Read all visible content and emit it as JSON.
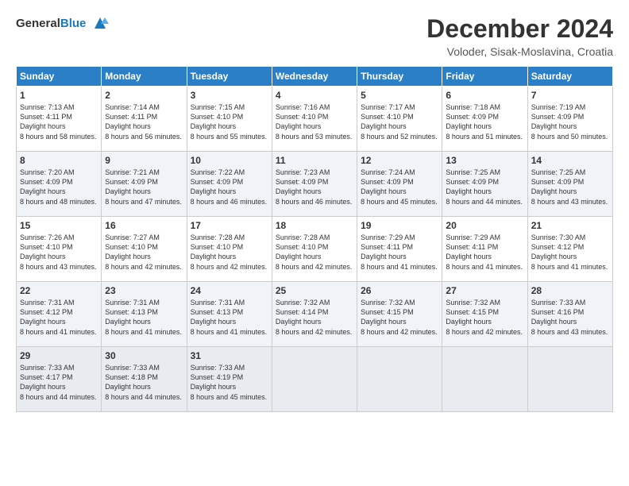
{
  "logo": {
    "line1": "General",
    "line2": "Blue"
  },
  "title": "December 2024",
  "location": "Voloder, Sisak-Moslavina, Croatia",
  "days_of_week": [
    "Sunday",
    "Monday",
    "Tuesday",
    "Wednesday",
    "Thursday",
    "Friday",
    "Saturday"
  ],
  "weeks": [
    [
      {
        "day": "1",
        "sunrise": "7:13 AM",
        "sunset": "4:11 PM",
        "daylight": "8 hours and 58 minutes."
      },
      {
        "day": "2",
        "sunrise": "7:14 AM",
        "sunset": "4:11 PM",
        "daylight": "8 hours and 56 minutes."
      },
      {
        "day": "3",
        "sunrise": "7:15 AM",
        "sunset": "4:10 PM",
        "daylight": "8 hours and 55 minutes."
      },
      {
        "day": "4",
        "sunrise": "7:16 AM",
        "sunset": "4:10 PM",
        "daylight": "8 hours and 53 minutes."
      },
      {
        "day": "5",
        "sunrise": "7:17 AM",
        "sunset": "4:10 PM",
        "daylight": "8 hours and 52 minutes."
      },
      {
        "day": "6",
        "sunrise": "7:18 AM",
        "sunset": "4:09 PM",
        "daylight": "8 hours and 51 minutes."
      },
      {
        "day": "7",
        "sunrise": "7:19 AM",
        "sunset": "4:09 PM",
        "daylight": "8 hours and 50 minutes."
      }
    ],
    [
      {
        "day": "8",
        "sunrise": "7:20 AM",
        "sunset": "4:09 PM",
        "daylight": "8 hours and 48 minutes."
      },
      {
        "day": "9",
        "sunrise": "7:21 AM",
        "sunset": "4:09 PM",
        "daylight": "8 hours and 47 minutes."
      },
      {
        "day": "10",
        "sunrise": "7:22 AM",
        "sunset": "4:09 PM",
        "daylight": "8 hours and 46 minutes."
      },
      {
        "day": "11",
        "sunrise": "7:23 AM",
        "sunset": "4:09 PM",
        "daylight": "8 hours and 46 minutes."
      },
      {
        "day": "12",
        "sunrise": "7:24 AM",
        "sunset": "4:09 PM",
        "daylight": "8 hours and 45 minutes."
      },
      {
        "day": "13",
        "sunrise": "7:25 AM",
        "sunset": "4:09 PM",
        "daylight": "8 hours and 44 minutes."
      },
      {
        "day": "14",
        "sunrise": "7:25 AM",
        "sunset": "4:09 PM",
        "daylight": "8 hours and 43 minutes."
      }
    ],
    [
      {
        "day": "15",
        "sunrise": "7:26 AM",
        "sunset": "4:10 PM",
        "daylight": "8 hours and 43 minutes."
      },
      {
        "day": "16",
        "sunrise": "7:27 AM",
        "sunset": "4:10 PM",
        "daylight": "8 hours and 42 minutes."
      },
      {
        "day": "17",
        "sunrise": "7:28 AM",
        "sunset": "4:10 PM",
        "daylight": "8 hours and 42 minutes."
      },
      {
        "day": "18",
        "sunrise": "7:28 AM",
        "sunset": "4:10 PM",
        "daylight": "8 hours and 42 minutes."
      },
      {
        "day": "19",
        "sunrise": "7:29 AM",
        "sunset": "4:11 PM",
        "daylight": "8 hours and 41 minutes."
      },
      {
        "day": "20",
        "sunrise": "7:29 AM",
        "sunset": "4:11 PM",
        "daylight": "8 hours and 41 minutes."
      },
      {
        "day": "21",
        "sunrise": "7:30 AM",
        "sunset": "4:12 PM",
        "daylight": "8 hours and 41 minutes."
      }
    ],
    [
      {
        "day": "22",
        "sunrise": "7:31 AM",
        "sunset": "4:12 PM",
        "daylight": "8 hours and 41 minutes."
      },
      {
        "day": "23",
        "sunrise": "7:31 AM",
        "sunset": "4:13 PM",
        "daylight": "8 hours and 41 minutes."
      },
      {
        "day": "24",
        "sunrise": "7:31 AM",
        "sunset": "4:13 PM",
        "daylight": "8 hours and 41 minutes."
      },
      {
        "day": "25",
        "sunrise": "7:32 AM",
        "sunset": "4:14 PM",
        "daylight": "8 hours and 42 minutes."
      },
      {
        "day": "26",
        "sunrise": "7:32 AM",
        "sunset": "4:15 PM",
        "daylight": "8 hours and 42 minutes."
      },
      {
        "day": "27",
        "sunrise": "7:32 AM",
        "sunset": "4:15 PM",
        "daylight": "8 hours and 42 minutes."
      },
      {
        "day": "28",
        "sunrise": "7:33 AM",
        "sunset": "4:16 PM",
        "daylight": "8 hours and 43 minutes."
      }
    ],
    [
      {
        "day": "29",
        "sunrise": "7:33 AM",
        "sunset": "4:17 PM",
        "daylight": "8 hours and 44 minutes."
      },
      {
        "day": "30",
        "sunrise": "7:33 AM",
        "sunset": "4:18 PM",
        "daylight": "8 hours and 44 minutes."
      },
      {
        "day": "31",
        "sunrise": "7:33 AM",
        "sunset": "4:19 PM",
        "daylight": "8 hours and 45 minutes."
      },
      null,
      null,
      null,
      null
    ]
  ]
}
